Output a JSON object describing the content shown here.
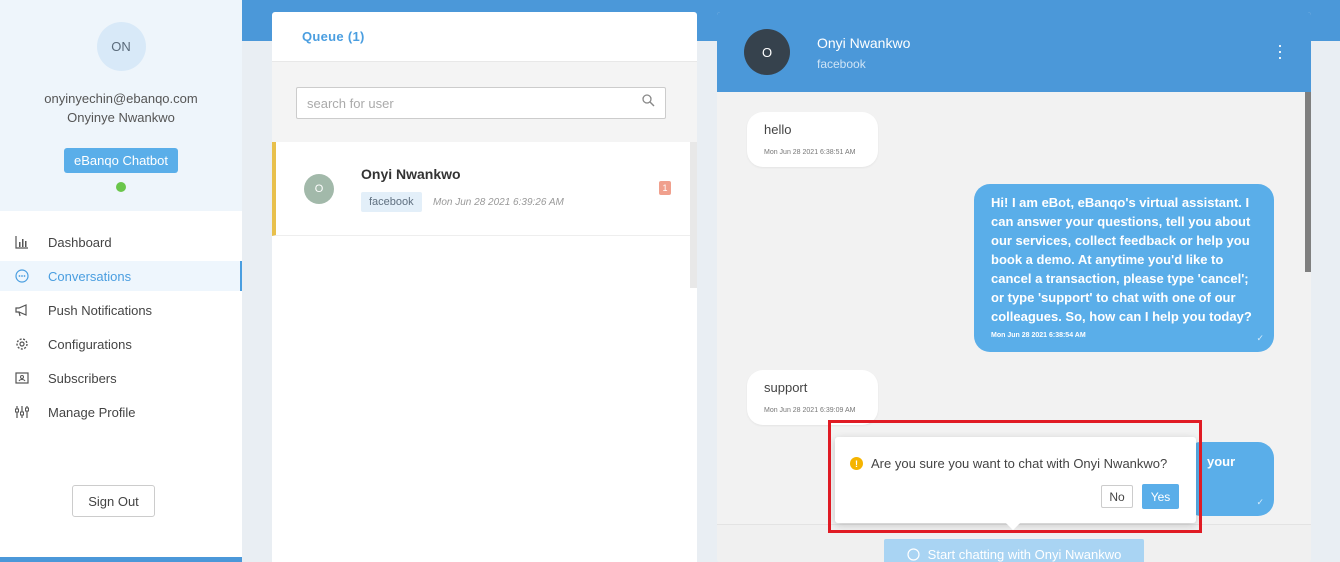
{
  "sidebar": {
    "avatar_initials": "ON",
    "email": "onyinyechin@ebanqo.com",
    "name": "Onyinye Nwankwo",
    "bot_label": "eBanqo Chatbot",
    "status_color": "#6ac64b",
    "nav": [
      {
        "label": "Dashboard",
        "icon": "bar-chart-icon",
        "active": false
      },
      {
        "label": "Conversations",
        "icon": "chat-bubble-icon",
        "active": true
      },
      {
        "label": "Push Notifications",
        "icon": "megaphone-icon",
        "active": false
      },
      {
        "label": "Configurations",
        "icon": "gear-icon",
        "active": false
      },
      {
        "label": "Subscribers",
        "icon": "contact-card-icon",
        "active": false
      },
      {
        "label": "Manage Profile",
        "icon": "sliders-icon",
        "active": false
      }
    ],
    "signout_label": "Sign Out"
  },
  "queue": {
    "title": "Queue (1)",
    "search_placeholder": "search for user",
    "items": [
      {
        "initial": "O",
        "name": "Onyi Nwankwo",
        "channel": "facebook",
        "time": "Mon Jun 28 2021 6:39:26 AM",
        "unread": "1"
      }
    ]
  },
  "chat": {
    "avatar_initial": "O",
    "name": "Onyi Nwankwo",
    "channel": "facebook",
    "messages": [
      {
        "dir": "in",
        "text": "hello",
        "time": "Mon Jun 28 2021 6:38:51 AM"
      },
      {
        "dir": "out",
        "text": "Hi! I am eBot, eBanqo's virtual assistant. I can answer your questions, tell you about our services, collect feedback or help you book a demo. At anytime you'd like to cancel a transaction, please type 'cancel'; or type 'support' to chat with one of our colleagues. So, how can I help you today?",
        "time": "Mon Jun 28 2021 6:38:54 AM"
      },
      {
        "dir": "in",
        "text": "support",
        "time": "Mon Jun 28 2021 6:39:09 AM"
      },
      {
        "dir": "out",
        "text": "your",
        "time": ""
      }
    ],
    "start_button": "Start chatting with Onyi Nwankwo"
  },
  "confirm": {
    "text": "Are you sure you want to chat with Onyi Nwankwo?",
    "no_label": "No",
    "yes_label": "Yes"
  },
  "colors": {
    "brand": "#4b98d9",
    "accent": "#5aaee9",
    "highlight": "#e01b24",
    "queue_marker": "#e8c04c"
  }
}
